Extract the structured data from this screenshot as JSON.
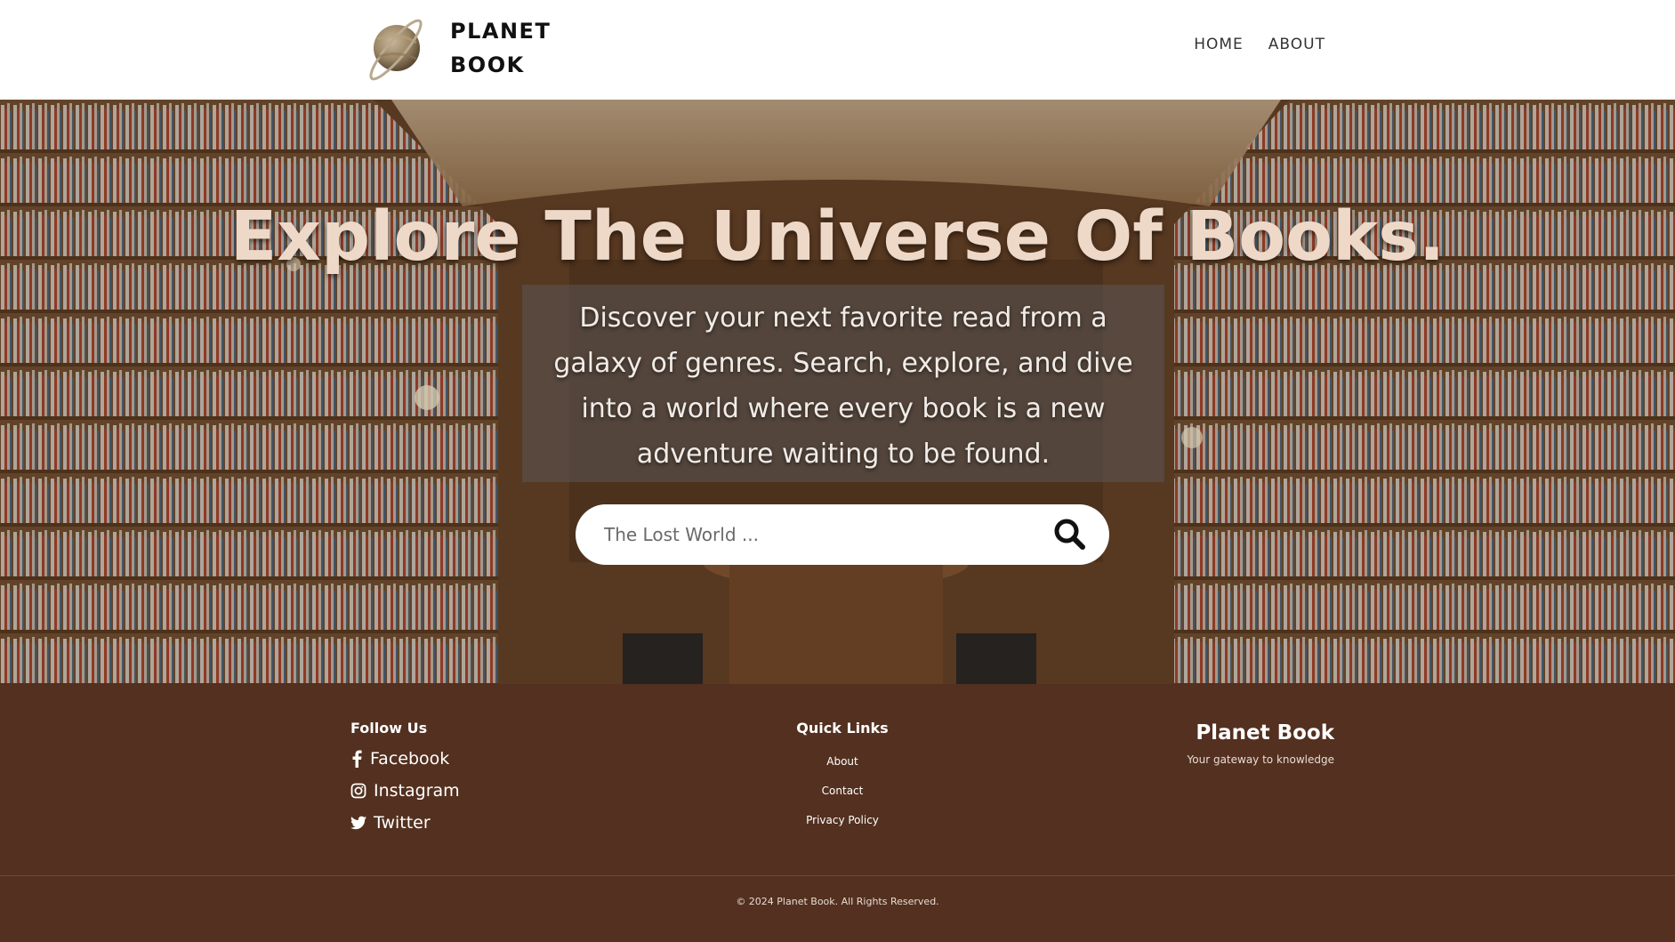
{
  "header": {
    "brand_line1": "PLANET",
    "brand_line2": "BOOK",
    "nav": [
      "HOME",
      "ABOUT"
    ]
  },
  "hero": {
    "title": "Explore The Universe Of Books.",
    "description": "Discover your next favorite read from a galaxy of genres. Search, explore, and dive into a world where every book is a new adventure waiting to be found.",
    "search_placeholder": "The Lost World ...",
    "search_icon": "search-icon"
  },
  "footer": {
    "follow_heading": "Follow Us",
    "social": [
      {
        "label": "Facebook",
        "icon": "facebook-icon"
      },
      {
        "label": "Instagram",
        "icon": "instagram-icon"
      },
      {
        "label": "Twitter",
        "icon": "twitter-icon"
      }
    ],
    "quick_heading": "Quick Links",
    "quick_links": [
      "About",
      "Contact",
      "Privacy Policy"
    ],
    "brand_title": "Planet Book",
    "brand_tagline": "Your gateway to knowledge",
    "copyright": "© 2024 Planet Book. All Rights Reserved."
  },
  "colors": {
    "footer_bg": "#53301f",
    "hero_title": "#eed8c8",
    "header_bg": "#ffffff"
  }
}
